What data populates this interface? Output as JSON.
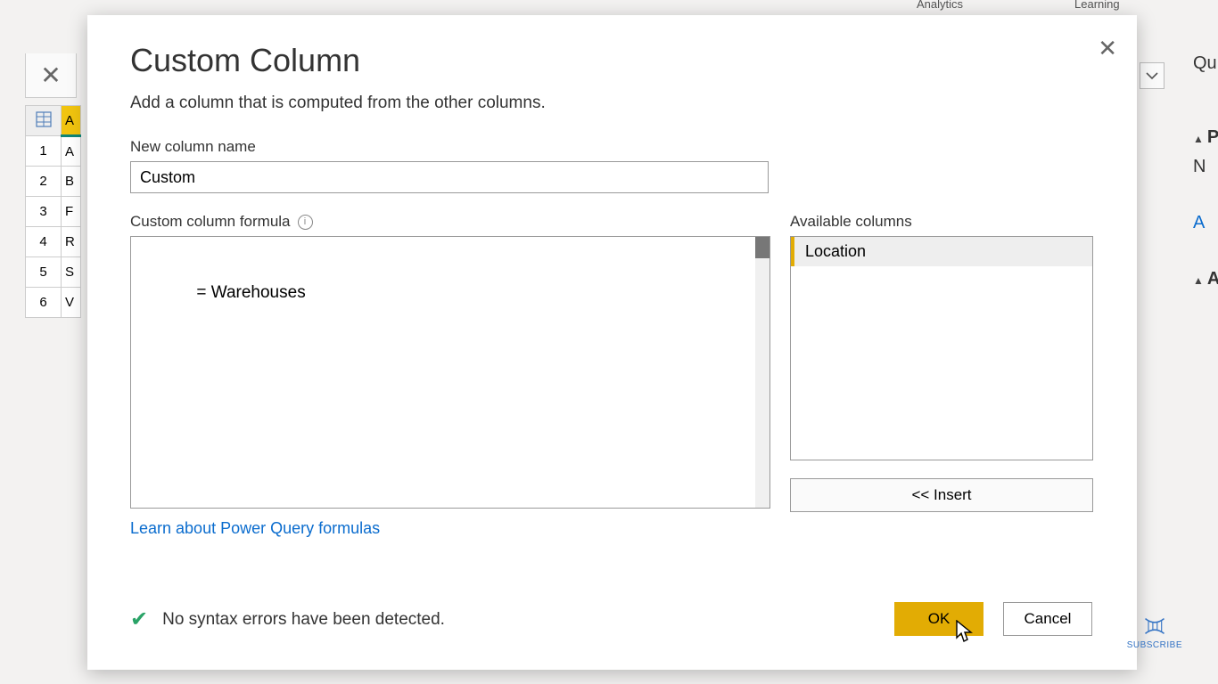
{
  "ribbon": {
    "group1": "Analytics",
    "group2": "Learning"
  },
  "right_panel": {
    "queries": "Qu",
    "p_label": "P",
    "n_label": "N",
    "a_label": "A",
    "a2_label": "A"
  },
  "bg_table": {
    "header_col": "A",
    "rows": [
      "1",
      "2",
      "3",
      "4",
      "5",
      "6"
    ],
    "cells": [
      "A",
      "B",
      "F",
      "R",
      "S",
      "V"
    ]
  },
  "dialog": {
    "title": "Custom Column",
    "subtitle": "Add a column that is computed from the other columns.",
    "name_label": "New column name",
    "name_value": "Custom",
    "formula_label": "Custom column formula",
    "formula_value": "= Warehouses",
    "available_label": "Available columns",
    "available_items": [
      "Location"
    ],
    "insert_label": "<< Insert",
    "learn_link": "Learn about Power Query formulas",
    "status_text": "No syntax errors have been detected.",
    "ok_label": "OK",
    "cancel_label": "Cancel"
  },
  "subscribe": {
    "label": "SUBSCRIBE"
  }
}
